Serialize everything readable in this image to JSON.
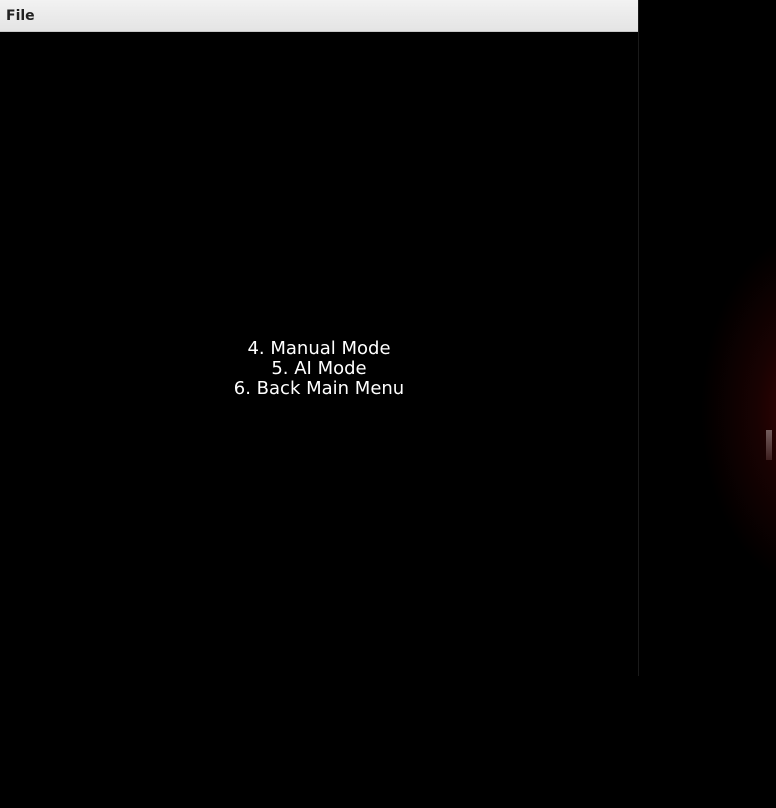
{
  "window": {
    "menubar": {
      "file_label": "File"
    }
  },
  "game_menu": {
    "options": [
      {
        "label": "4. Manual Mode"
      },
      {
        "label": "5. AI Mode"
      },
      {
        "label": "6. Back Main Menu"
      }
    ]
  },
  "colors": {
    "background": "#000000",
    "menu_text": "#ffffff",
    "menubar_bg": "#ebebeb",
    "backdrop_glow": "#780a0a"
  }
}
